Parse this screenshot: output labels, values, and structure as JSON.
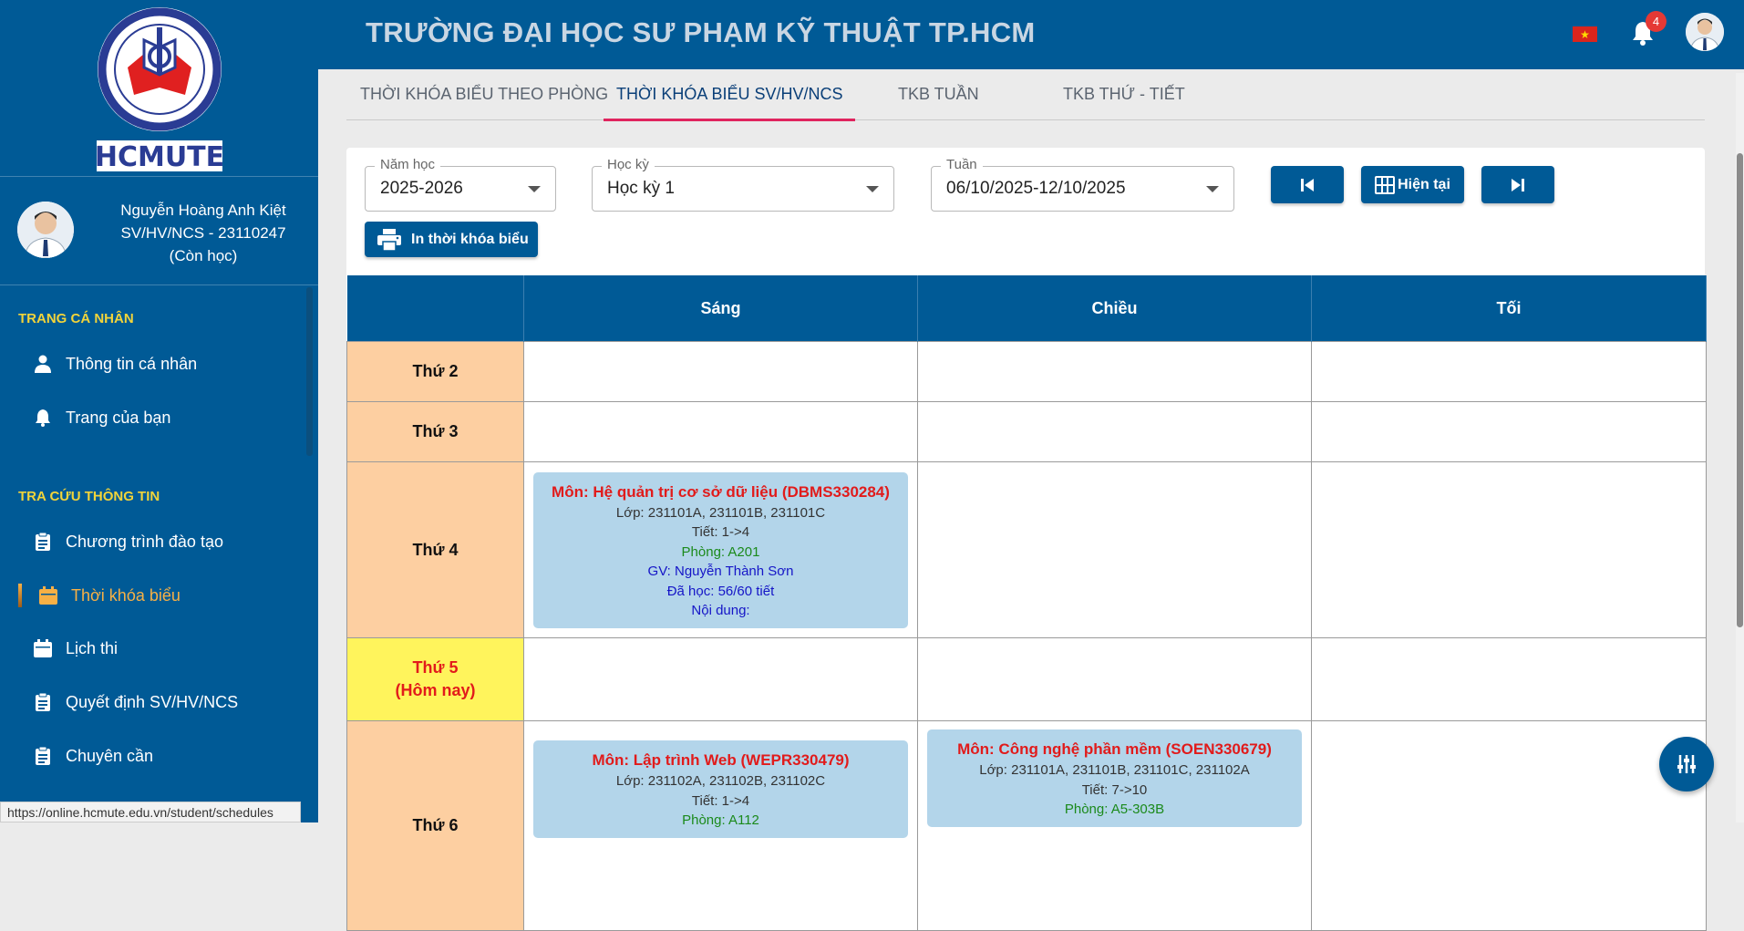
{
  "colors": {
    "primary": "#005a96",
    "accent_yellow": "#f2d43a",
    "active_orange": "#f7b045",
    "tab_underline": "#e0245e",
    "day_cell": "#fdcfa1",
    "today_cell": "#fff45c",
    "card_bg": "#b3d5ea",
    "subject_red": "#e11b1b"
  },
  "brand": {
    "logo_text": "HCMUTE"
  },
  "header": {
    "title": "TRƯỜNG ĐẠI HỌC SƯ PHẠM KỸ THUẬT TP.HCM",
    "notification_count": "4"
  },
  "profile": {
    "name": "Nguyễn Hoàng Anh Kiệt",
    "id_line": "SV/HV/NCS - 23110247",
    "status": "(Còn học)"
  },
  "sidebar": {
    "section1": "TRANG CÁ NHÂN",
    "items1": [
      {
        "label": "Thông tin cá nhân",
        "icon": "person-icon"
      },
      {
        "label": "Trang của bạn",
        "icon": "bell-icon"
      }
    ],
    "section2": "TRA CỨU THÔNG TIN",
    "items2": [
      {
        "label": "Chương trình đào tạo",
        "icon": "clipboard-icon"
      },
      {
        "label": "Thời khóa biểu",
        "icon": "calendar-icon",
        "active": true
      },
      {
        "label": "Lịch thi",
        "icon": "calendar-icon"
      },
      {
        "label": "Quyết định SV/HV/NCS",
        "icon": "clipboard-icon"
      },
      {
        "label": "Chuyên cần",
        "icon": "clipboard-icon"
      }
    ]
  },
  "tabs": [
    {
      "label": "THỜI KHÓA BIỂU THEO PHÒNG"
    },
    {
      "label": "THỜI KHÓA BIỂU SV/HV/NCS",
      "active": true
    },
    {
      "label": "TKB TUẦN"
    },
    {
      "label": "TKB THỨ - TIẾT"
    }
  ],
  "filters": {
    "year": {
      "label": "Năm học",
      "value": "2025-2026"
    },
    "semester": {
      "label": "Học kỳ",
      "value": "Học kỳ 1"
    },
    "week": {
      "label": "Tuần",
      "value": "06/10/2025-12/10/2025"
    }
  },
  "buttons": {
    "current": "Hiện tại",
    "print": "In thời khóa biểu"
  },
  "schedule": {
    "columns": [
      "Sáng",
      "Chiều",
      "Tối"
    ],
    "days": [
      {
        "label": "Thứ 2"
      },
      {
        "label": "Thứ 3"
      },
      {
        "label": "Thứ 4"
      },
      {
        "label": "Thứ 5",
        "sub": "(Hôm nay)"
      },
      {
        "label": "Thứ 6"
      }
    ],
    "classes": [
      {
        "subject": "Môn: Hệ quản trị cơ sở dữ liệu (DBMS330284)",
        "classes": "Lớp: 231101A, 231101B, 231101C",
        "periods": "Tiết: 1->4",
        "room": "Phòng: A201",
        "teacher": "GV: Nguyễn Thành Sơn",
        "progress": "Đã học: 56/60 tiết",
        "content": "Nội dung:"
      },
      {
        "subject": "Môn: Lập trình Web (WEPR330479)",
        "classes": "Lớp: 231102A, 231102B, 231102C",
        "periods": "Tiết: 1->4",
        "room": "Phòng: A112"
      },
      {
        "subject": "Môn: Công nghệ phần mềm (SOEN330679)",
        "classes": "Lớp: 231101A, 231101B, 231101C, 231102A",
        "periods": "Tiết: 7->10",
        "room": "Phòng: A5-303B"
      }
    ]
  },
  "status_url": "https://online.hcmute.edu.vn/student/schedules"
}
